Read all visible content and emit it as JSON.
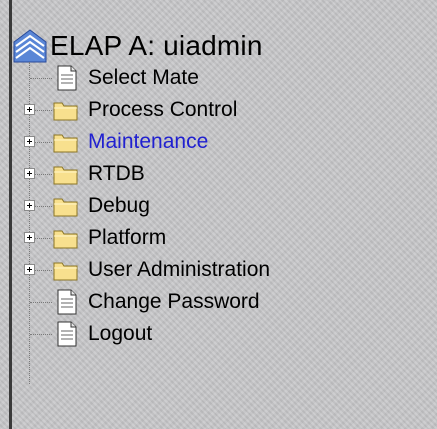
{
  "tree": {
    "root_label": "ELAP A: uiadmin",
    "root_icon": "network-icon",
    "items": [
      {
        "label": "Select Mate",
        "type": "page",
        "icon": "page-icon",
        "expandable": false,
        "highlighted": false
      },
      {
        "label": "Process Control",
        "type": "folder",
        "icon": "folder-icon",
        "expandable": true,
        "highlighted": false
      },
      {
        "label": "Maintenance",
        "type": "folder",
        "icon": "folder-icon",
        "expandable": true,
        "highlighted": true
      },
      {
        "label": "RTDB",
        "type": "folder",
        "icon": "folder-icon",
        "expandable": true,
        "highlighted": false
      },
      {
        "label": "Debug",
        "type": "folder",
        "icon": "folder-icon",
        "expandable": true,
        "highlighted": false
      },
      {
        "label": "Platform",
        "type": "folder",
        "icon": "folder-icon",
        "expandable": true,
        "highlighted": false
      },
      {
        "label": "User Administration",
        "type": "folder",
        "icon": "folder-icon",
        "expandable": true,
        "highlighted": false
      },
      {
        "label": "Change Password",
        "type": "page",
        "icon": "page-icon",
        "expandable": false,
        "highlighted": false
      },
      {
        "label": "Logout",
        "type": "page",
        "icon": "page-icon",
        "expandable": false,
        "highlighted": false
      }
    ]
  },
  "colors": {
    "background": "#c6c6c8",
    "highlight_text": "#2020d0",
    "folder_fill": "#f8e08e",
    "folder_stroke": "#8a7424"
  }
}
